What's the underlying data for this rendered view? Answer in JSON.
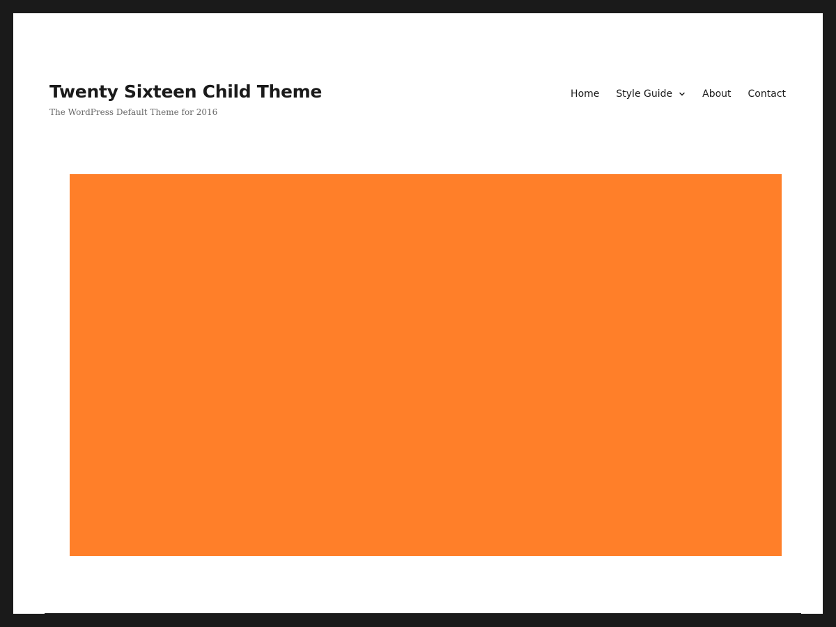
{
  "site": {
    "title": "Twenty Sixteen Child Theme",
    "description": "The WordPress Default Theme for 2016"
  },
  "nav": {
    "items": [
      {
        "label": "Home"
      },
      {
        "label": "Style Guide",
        "has_submenu": true,
        "icon": "chevron-down-icon"
      },
      {
        "label": "About"
      },
      {
        "label": "Contact"
      }
    ]
  },
  "colors": {
    "hero_block": "#ff7f29",
    "frame_border": "#1a1a1a",
    "page_background": "#ffffff",
    "text": "#1a1a1a"
  }
}
